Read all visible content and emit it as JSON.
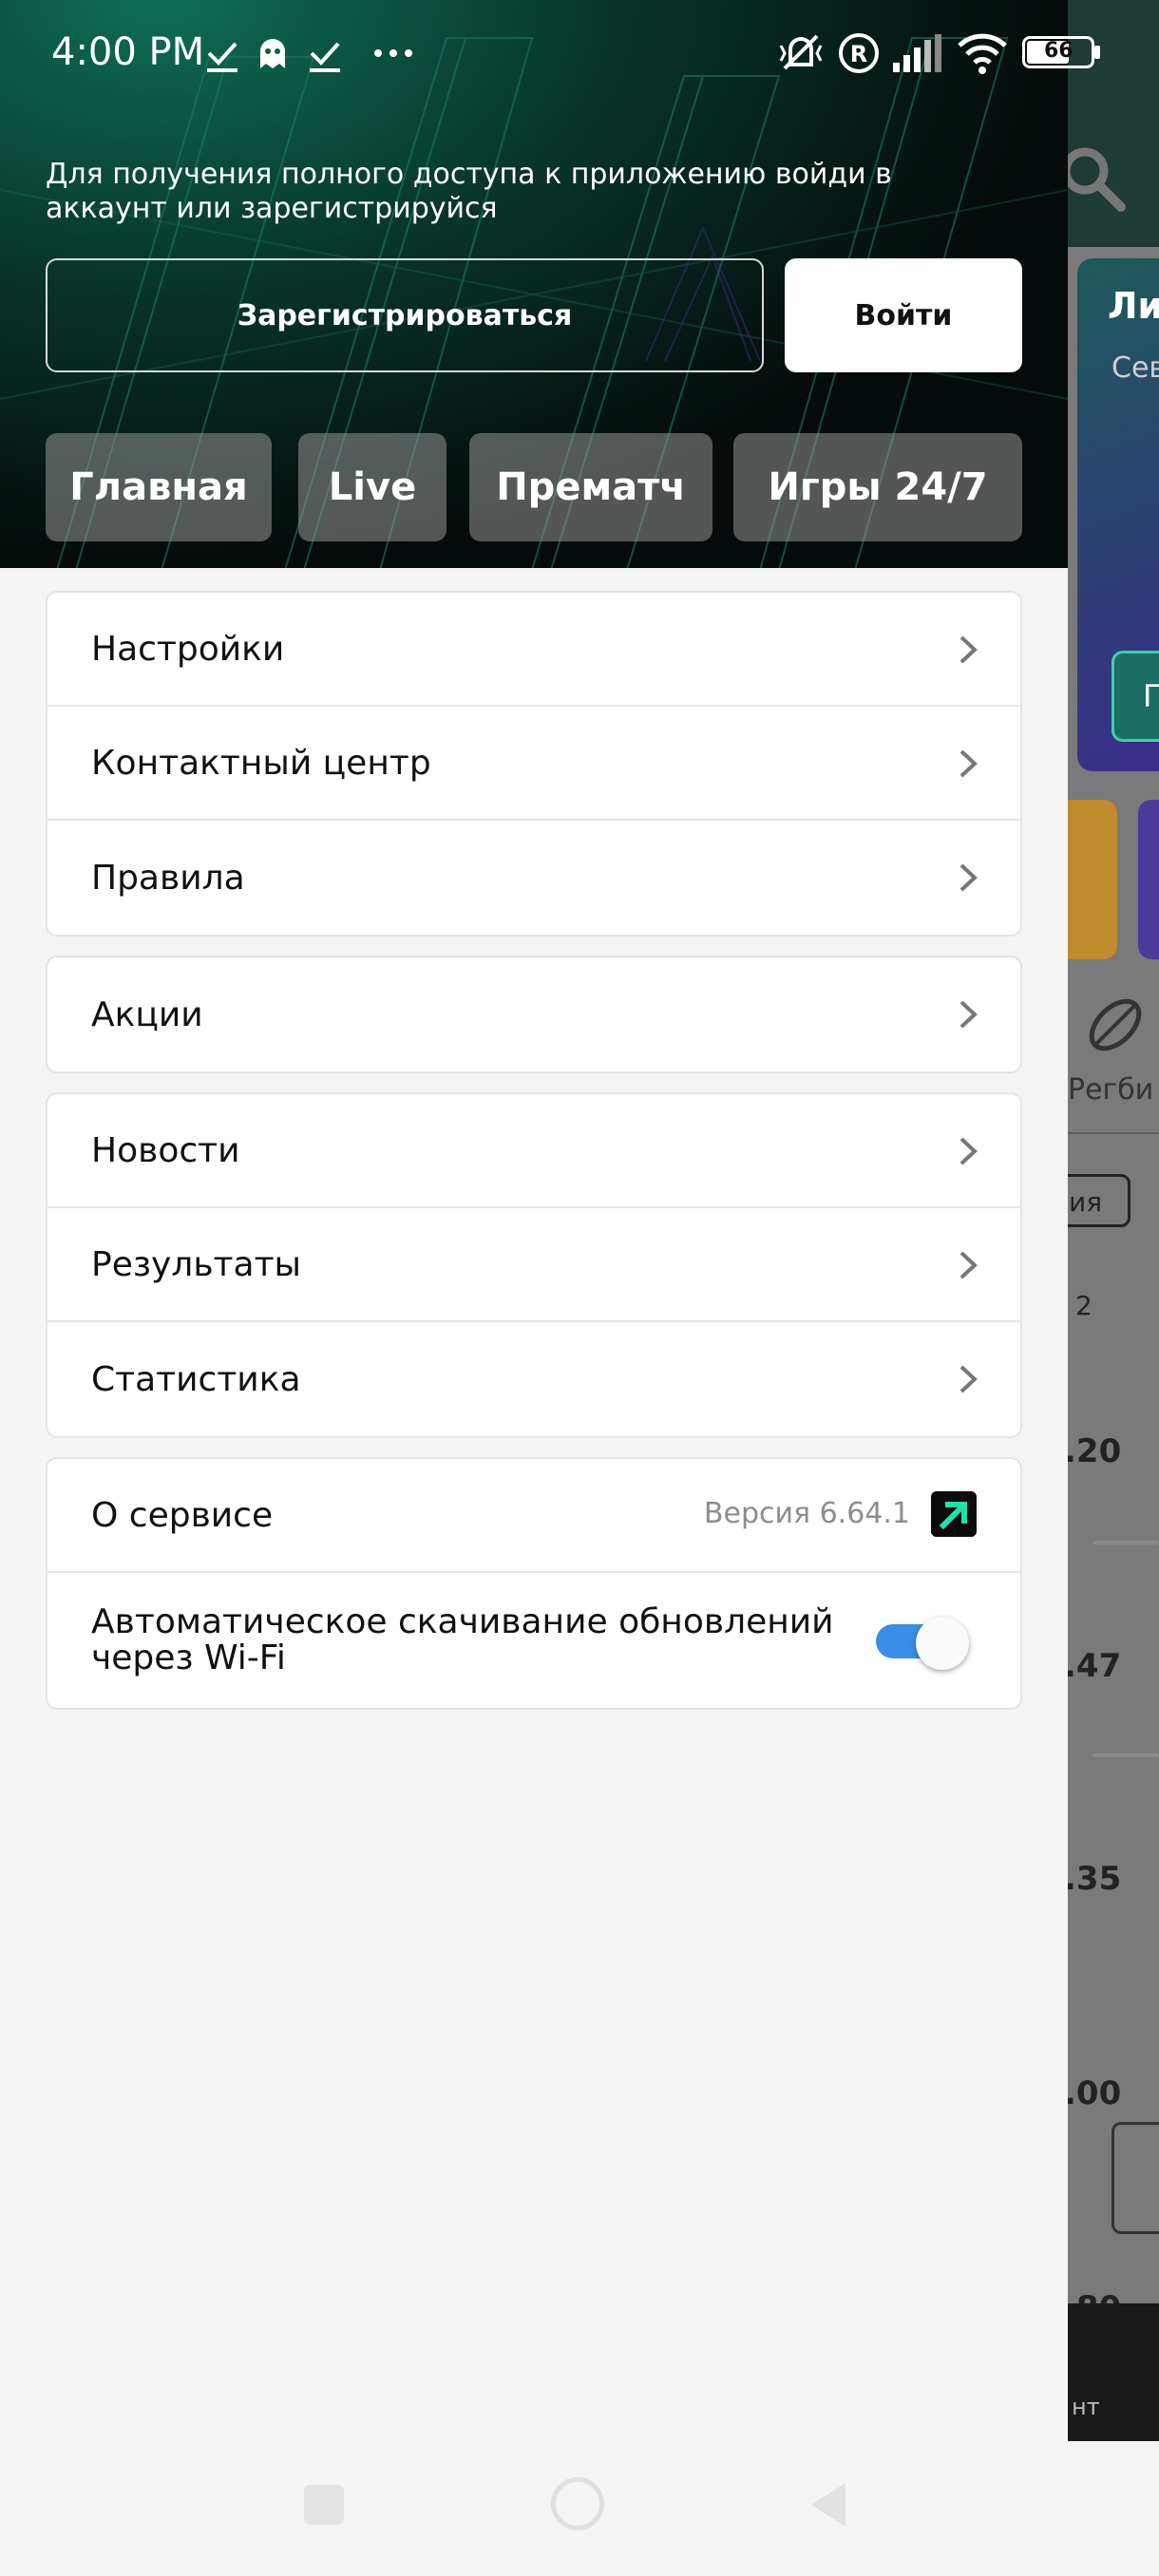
{
  "status_bar": {
    "time": "4:00 PM",
    "battery": "66"
  },
  "drawer": {
    "login_prompt": "Для получения полного доступа к приложению войди в аккаунт или зарегистрируйся",
    "register_button": "Зарегистрироваться",
    "login_button": "Войти",
    "tabs": [
      "Главная",
      "Live",
      "Прематч",
      "Игры 24/7"
    ],
    "menu_group_1": [
      "Настройки",
      "Контактный центр",
      "Правила"
    ],
    "menu_group_2": [
      "Акции"
    ],
    "menu_group_3": [
      "Новости",
      "Результаты",
      "Статистика"
    ],
    "about": {
      "label": "О сервисе",
      "version": "Версия 6.64.1"
    },
    "auto_update": {
      "label": "Автоматическое скачивание обновлений через Wi-Fi",
      "enabled": true
    }
  },
  "background_app": {
    "card_title": "Ли",
    "card_subtitle": "Сев",
    "card_button": "П",
    "sport_label": "Регби",
    "chip_label": "ия",
    "column_header": "2",
    "odds": [
      ".20",
      ".47",
      ".35",
      ".00",
      ".80"
    ],
    "bottom_label": "нт"
  },
  "colors": {
    "accent_toggle": "#3a8ee6",
    "brand_green": "#1ee0b0",
    "header_dark": "#050b0a"
  }
}
